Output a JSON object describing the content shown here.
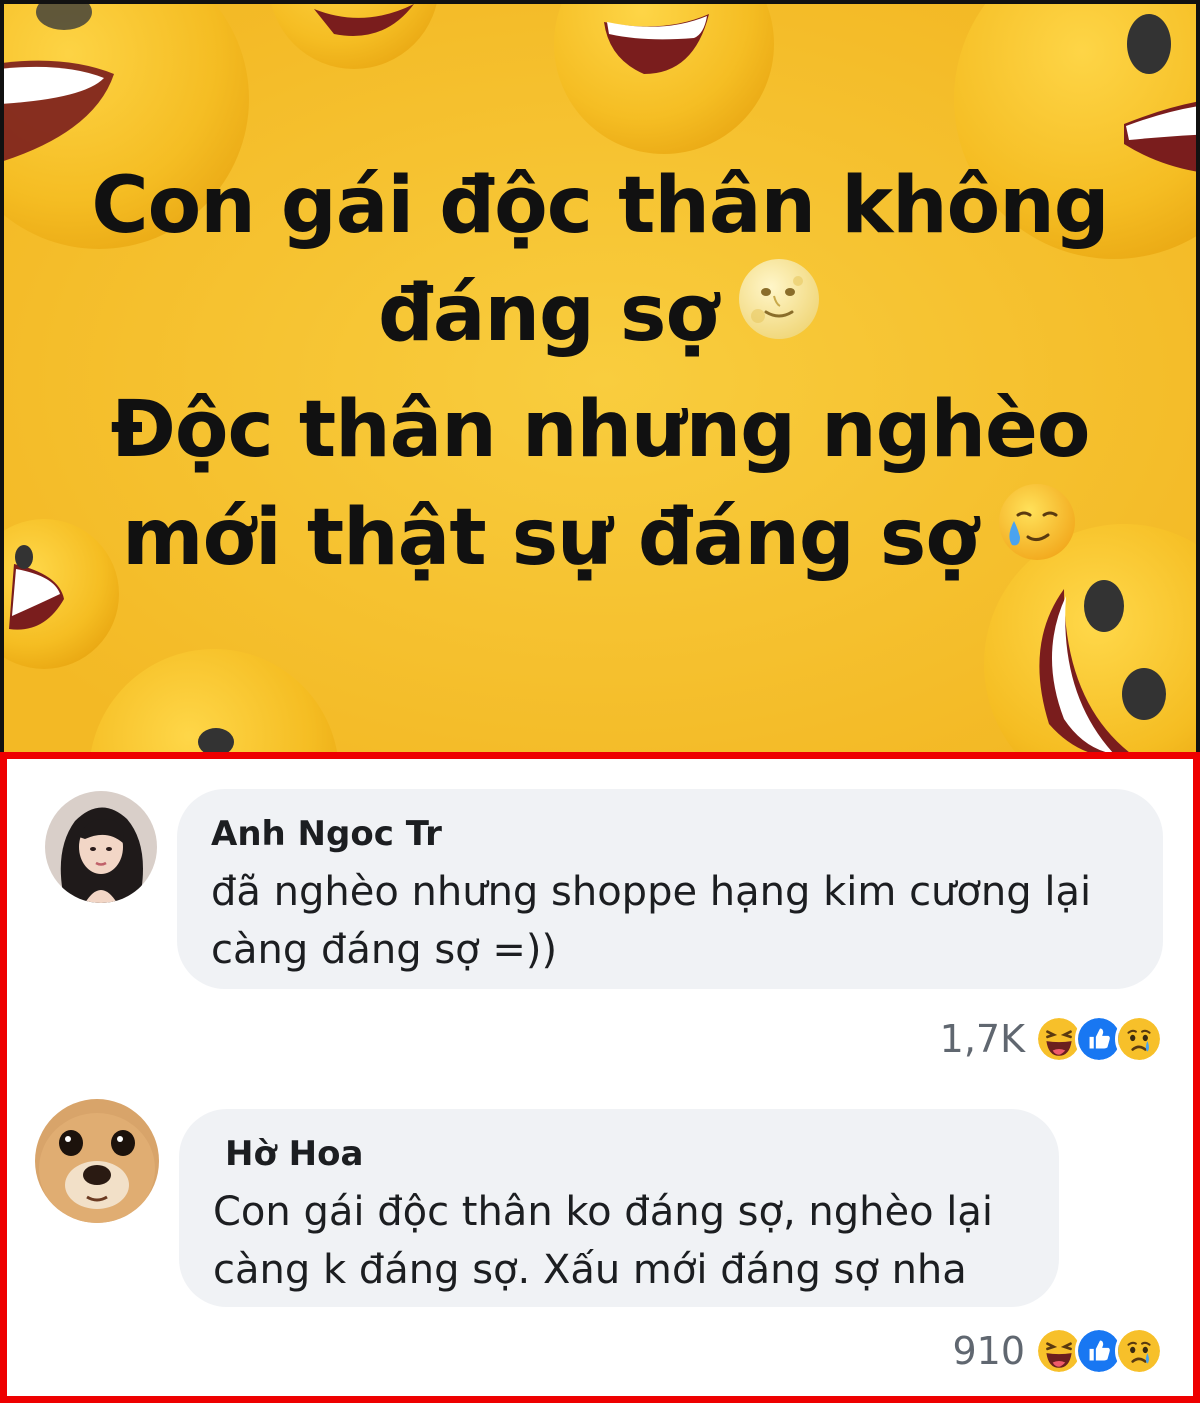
{
  "post": {
    "lines": [
      "Con gái độc thân không",
      "đáng sợ",
      "Độc thân nhưng nghèo",
      "mới thật sự đáng sợ"
    ],
    "emoji_1": "full-moon-face",
    "emoji_2": "crying-smile-face",
    "background_color": "#f6c02e"
  },
  "comments": [
    {
      "author": "Anh Ngoc Tr",
      "text_line_1": "đã nghèo nhưng shoppe hạng kim cương lại",
      "text_line_2": "càng đáng sợ =))",
      "reaction_count": "1,7K",
      "reactions": [
        "haha",
        "like",
        "sad"
      ]
    },
    {
      "author": "Hờ Hoa",
      "text_line_1": "Con gái độc thân ko đáng sợ, nghèo lại",
      "text_line_2": "càng k đáng sợ. Xấu mới đáng sợ nha",
      "reaction_count": "910",
      "reactions": [
        "haha",
        "like",
        "sad"
      ]
    }
  ],
  "colors": {
    "highlight_border": "#ee0000",
    "bubble": "#f0f2f5",
    "like_blue": "#1877f2"
  }
}
